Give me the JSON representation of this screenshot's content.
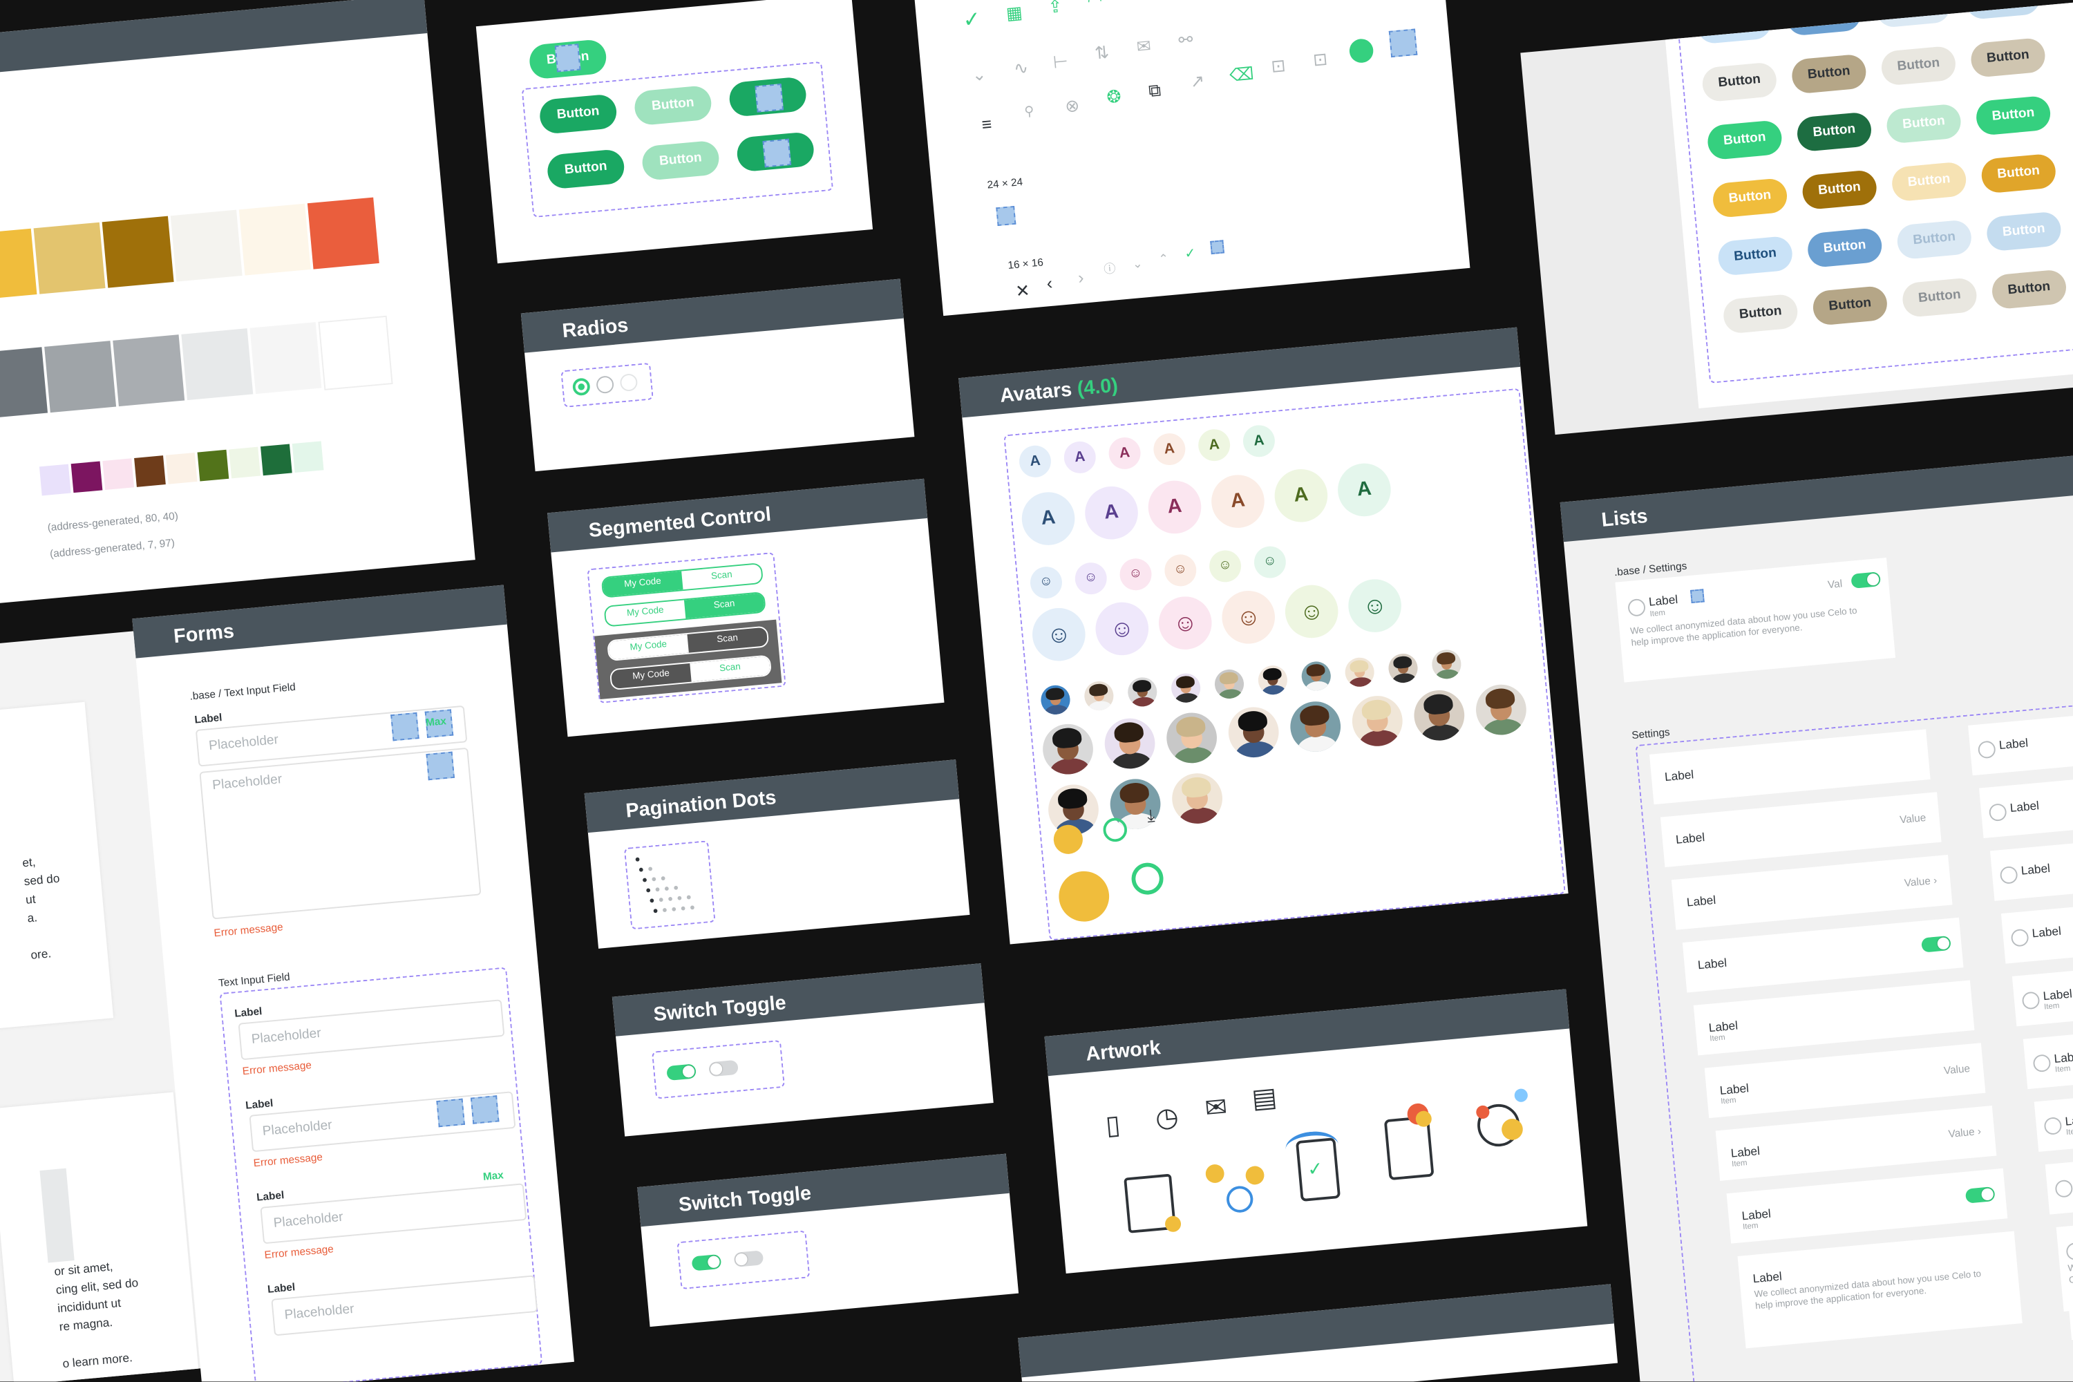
{
  "colors": {
    "row1": [
      "#f0bd3c",
      "#e3c46e",
      "#9f700a",
      "#f4f3ef",
      "#fdf6e9",
      "#ea5e3d"
    ],
    "row2": [
      "#6e757b",
      "#9fa4a8",
      "#a9adb1",
      "#e7e9ea",
      "#f5f5f5",
      "#ffffff"
    ],
    "row3": [
      "#e9e1fb",
      "#7c1560",
      "#fae3ef",
      "#6e3c1a",
      "#fbf1e6",
      "#52731a",
      "#eef6e6",
      "#1e6e3a",
      "#e3f6ea"
    ],
    "code_lines": [
      "(address-generated, 80, 40)",
      "(address-generated, 7, 97)"
    ],
    "green": "#35d07f",
    "dark_green": "#1d6d41"
  },
  "top_buttons": {
    "selected_label": "Button",
    "labels": [
      "Button",
      "Button",
      "Button",
      "Button"
    ]
  },
  "radios": {
    "title": "Radios"
  },
  "segmented": {
    "title": "Segmented Control",
    "rows": [
      {
        "left": "My Code",
        "right": "Scan"
      },
      {
        "left": "My Code",
        "right": "Scan"
      },
      {
        "left": "My Code",
        "right": "Scan"
      },
      {
        "left": "My Code",
        "right": "Scan"
      }
    ]
  },
  "pagination": {
    "title": "Pagination Dots"
  },
  "switch1": {
    "title": "Switch Toggle"
  },
  "switch2": {
    "title": "Switch Toggle"
  },
  "icons": {
    "size_large": "24 × 24",
    "size_small": "16 × 16"
  },
  "avatars": {
    "title": "Avatars",
    "version": "(4.0)",
    "letter": "A",
    "tints": [
      "#e3eef9",
      "#efe8fb",
      "#fbe6f0",
      "#fbede6",
      "#eef6e1",
      "#e4f6ec"
    ],
    "ink": [
      "#2d4f77",
      "#5a3f8f",
      "#8b2e5a",
      "#8a4a2a",
      "#4d6b1f",
      "#1f6b3f"
    ]
  },
  "artwork": {
    "title": "Artwork"
  },
  "forms": {
    "title": "Forms",
    "section1": ".base / Text Input Field",
    "section2": "Text Input Field",
    "label": "Label",
    "placeholder": "Placeholder",
    "error": "Error message",
    "max": "Max"
  },
  "left_text": {
    "lines1": [
      "et,",
      "sed do",
      "ut",
      "a.",
      "",
      "ore."
    ],
    "lines2": [
      "or sit amet,",
      "cing elit, sed do",
      "incididunt ut",
      "re magna.",
      "",
      "o learn more."
    ]
  },
  "buttons_grid": {
    "label": "Button",
    "rows": [
      [
        "#c9e2f7",
        "#6a9fd1",
        "#dbe9f4",
        "#c4dcef"
      ],
      [
        "#ecebe6",
        "#b5a687",
        "#e9e7e0",
        "#cfc5b0"
      ],
      [
        "#35d07f",
        "#1d6d41",
        "#bde9d0",
        "#35d07f"
      ],
      [
        "#f0bd3c",
        "#9f700a",
        "#f6e2b3",
        "#e0a52a"
      ],
      [
        "#c9e2f7",
        "#6a9fd1",
        "#dbe9f4",
        "#c4dcef"
      ],
      [
        "#ecebe6",
        "#b5a687",
        "#e9e7e0",
        "#cfc5b0"
      ]
    ],
    "text": [
      [
        "#1e4f7d",
        "#ffffff",
        "#a4bcd2",
        "#a4bcd2"
      ],
      [
        "#2e3338",
        "#2e3338",
        "#8a8f93",
        "#2e3338"
      ],
      [
        "#ffffff",
        "#ffffff",
        "#ffffff",
        "#ffffff"
      ],
      [
        "#ffffff",
        "#ffffff",
        "#ffffff",
        "#ffffff"
      ],
      [
        "#1e4f7d",
        "#ffffff",
        "#a4bcd2",
        "#ffffff"
      ],
      [
        "#2e3338",
        "#2e3338",
        "#8a8f93",
        "#2e3338"
      ]
    ]
  },
  "lists": {
    "title": "Lists",
    "section1": ".base / Settings",
    "section2": "Settings",
    "label": "Label",
    "item": "Item",
    "value": "Value",
    "value_short": "Val",
    "description": "We collect anonymized data about how you use Celo to help improve the application for everyone.",
    "description_cut": "We collect a use Celo to everyone."
  }
}
